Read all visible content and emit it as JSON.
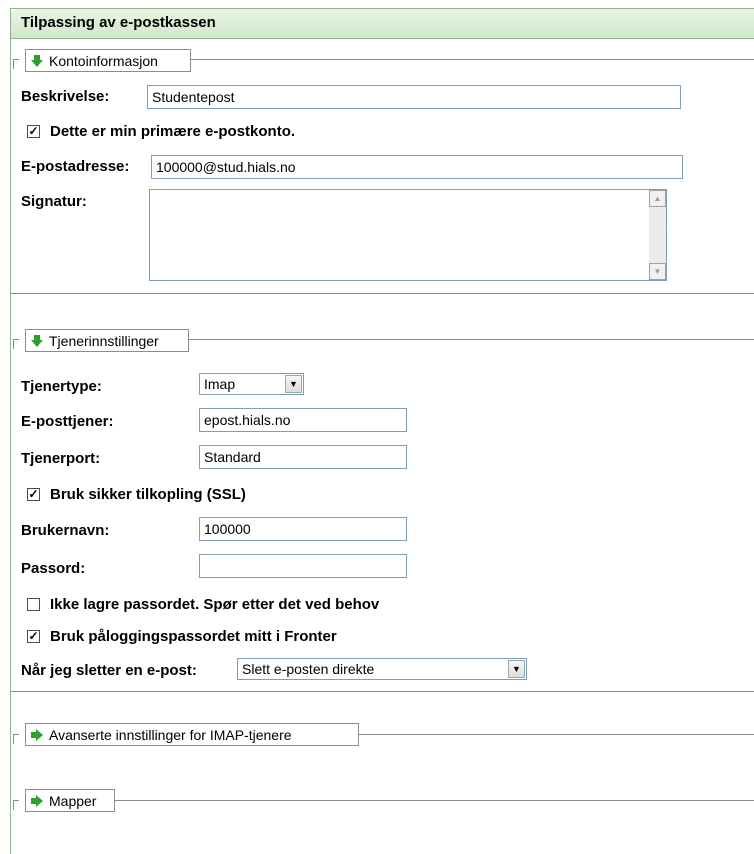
{
  "panel": {
    "title": "Tilpassing av e-postkassen"
  },
  "account": {
    "legend": "Kontoinformasjon",
    "description_label": "Beskrivelse:",
    "description_value": "Studentepost",
    "primary_label": "Dette er min primære e-postkonto.",
    "primary_checked": "✓",
    "email_label": "E-postadresse:",
    "email_value": "100000@stud.hials.no",
    "signature_label": "Signatur:"
  },
  "server": {
    "legend": "Tjenerinnstillinger",
    "type_label": "Tjenertype:",
    "type_value": "Imap",
    "host_label": "E-posttjener:",
    "host_value": "epost.hials.no",
    "port_label": "Tjenerport:",
    "port_value": "Standard",
    "ssl_label": "Bruk sikker tilkopling (SSL)",
    "ssl_checked": "✓",
    "username_label": "Brukernavn:",
    "username_value": "100000",
    "password_label": "Passord:",
    "password_value": "",
    "nosave_label": "Ikke lagre passordet. Spør etter det ved behov",
    "nosave_checked": "",
    "fronter_label": "Bruk påloggingspassordet mitt i Fronter",
    "fronter_checked": "✓",
    "delete_label": "Når jeg sletter en e-post:",
    "delete_value": "Slett e-posten direkte"
  },
  "advanced": {
    "legend": "Avanserte innstillinger for IMAP-tjenere"
  },
  "folders": {
    "legend": "Mapper"
  },
  "icons": {
    "section_open": "green-down-arrow-icon",
    "section_closed": "green-right-arrow-icon",
    "accent": "#2e9e2e"
  }
}
